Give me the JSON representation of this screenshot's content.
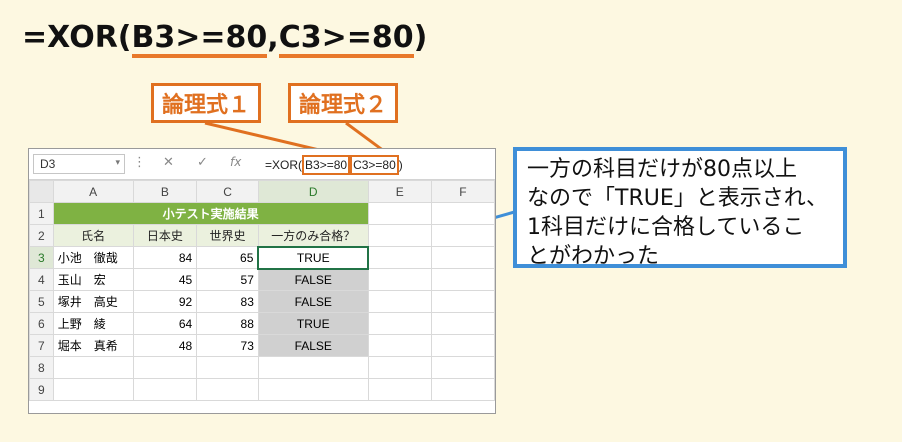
{
  "formula_title": {
    "prefix": "=XOR(",
    "arg1": "B3>=80",
    "comma": ",",
    "arg2": "C3>=80",
    "suffix": ")"
  },
  "tags": {
    "logic1": "論理式１",
    "logic2": "論理式２"
  },
  "formula_bar": {
    "name_box": "D3",
    "name_dropdown": "▾",
    "separator": "⋮",
    "cancel_icon": "✕",
    "confirm_icon": "✓",
    "fx_icon": "fx",
    "formula_prefix": "=XOR(",
    "formula_arg1": "B3>=80",
    "formula_arg2": "C3>=80",
    "formula_suffix": ")"
  },
  "columns": [
    "A",
    "B",
    "C",
    "D",
    "E",
    "F"
  ],
  "rows": [
    "1",
    "2",
    "3",
    "4",
    "5",
    "6",
    "7",
    "8",
    "9"
  ],
  "sheet": {
    "title": "小テスト実施結果",
    "headers": [
      "氏名",
      "日本史",
      "世界史",
      "一方のみ合格？"
    ],
    "data": [
      {
        "name": "小池　徹哉",
        "japanese": "84",
        "world": "65",
        "result": "TRUE"
      },
      {
        "name": "玉山　宏",
        "japanese": "45",
        "world": "57",
        "result": "FALSE"
      },
      {
        "name": "塚井　高史",
        "japanese": "92",
        "world": "83",
        "result": "FALSE"
      },
      {
        "name": "上野　綾",
        "japanese": "64",
        "world": "88",
        "result": "TRUE"
      },
      {
        "name": "堀本　真希",
        "japanese": "48",
        "world": "73",
        "result": "FALSE"
      }
    ]
  },
  "callout": {
    "line1": "一方の科目だけが80点以上",
    "line2": "なので「TRUE」と表示され、",
    "line3": "1科目だけに合格しているこ",
    "line4": "とがわかった"
  },
  "colors": {
    "accent_orange": "#e07020",
    "callout_blue": "#3f8fd8",
    "title_green": "#7fb243",
    "background": "#fdf8e1"
  }
}
